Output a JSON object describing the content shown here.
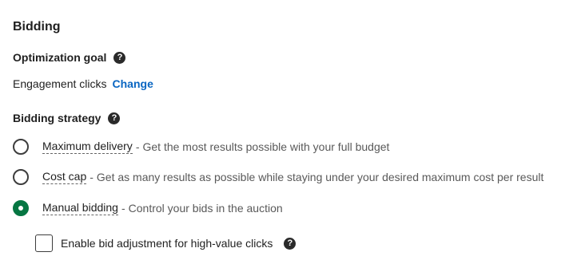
{
  "bidding": {
    "title": "Bidding",
    "optimization_goal": {
      "label": "Optimization goal",
      "help_icon": "?",
      "value": "Engagement clicks",
      "change_label": "Change"
    },
    "strategy": {
      "label": "Bidding strategy",
      "help_icon": "?",
      "options": [
        {
          "name": "Maximum delivery",
          "separator": "-",
          "description": "Get the most results possible with your full budget",
          "selected": false
        },
        {
          "name": "Cost cap",
          "separator": "-",
          "description": "Get as many results as possible while staying under your desired maximum cost per result",
          "selected": false
        },
        {
          "name": "Manual bidding",
          "separator": "-",
          "description": "Control your bids in the auction",
          "selected": true
        }
      ]
    },
    "bid_adjustment": {
      "label": "Enable bid adjustment for high-value clicks",
      "checked": false,
      "help_icon": "?"
    }
  },
  "colors": {
    "accent_green": "#057642",
    "link_blue": "#0a66c2",
    "text_dark": "#1f1f1f",
    "text_muted": "#595959"
  }
}
